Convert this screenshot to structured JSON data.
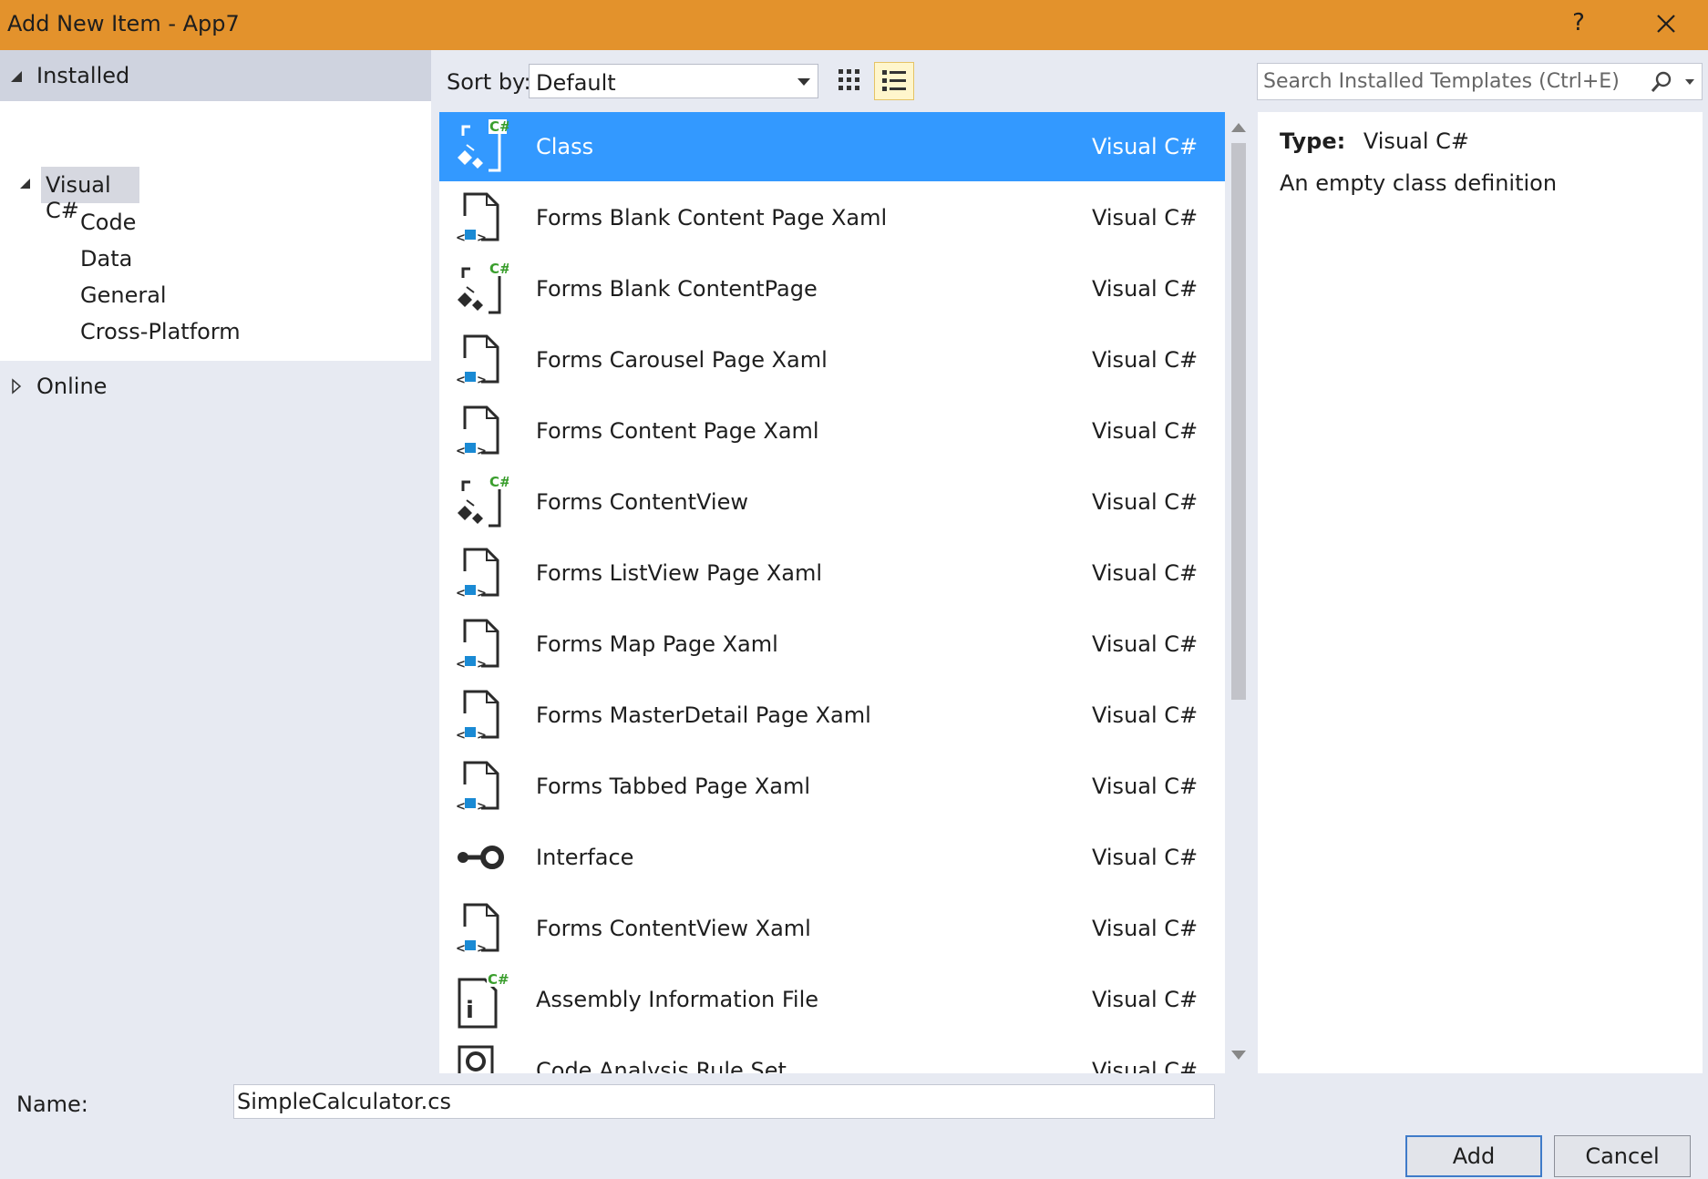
{
  "window": {
    "title": "Add New Item - App7",
    "help_label": "?"
  },
  "tree": {
    "installed_label": "Installed",
    "items": [
      {
        "label": "Visual C#"
      },
      {
        "label": "Code"
      },
      {
        "label": "Data"
      },
      {
        "label": "General"
      },
      {
        "label": "Cross-Platform"
      }
    ],
    "online_label": "Online"
  },
  "toolbar": {
    "sort_label": "Sort by:",
    "sort_value": "Default",
    "search_placeholder": "Search Installed Templates (Ctrl+E)"
  },
  "templates": [
    {
      "name": "Class",
      "lang": "Visual C#",
      "icon": "class-csharp-icon",
      "selected": true
    },
    {
      "name": "Forms Blank Content Page Xaml",
      "lang": "Visual C#",
      "icon": "xaml-page-icon"
    },
    {
      "name": "Forms Blank ContentPage",
      "lang": "Visual C#",
      "icon": "class-csharp-icon"
    },
    {
      "name": "Forms Carousel Page Xaml",
      "lang": "Visual C#",
      "icon": "xaml-page-icon"
    },
    {
      "name": "Forms Content Page Xaml",
      "lang": "Visual C#",
      "icon": "xaml-page-icon"
    },
    {
      "name": "Forms ContentView",
      "lang": "Visual C#",
      "icon": "class-csharp-icon"
    },
    {
      "name": "Forms ListView Page Xaml",
      "lang": "Visual C#",
      "icon": "xaml-page-icon"
    },
    {
      "name": "Forms Map Page Xaml",
      "lang": "Visual C#",
      "icon": "xaml-page-icon"
    },
    {
      "name": "Forms MasterDetail Page Xaml",
      "lang": "Visual C#",
      "icon": "xaml-page-icon"
    },
    {
      "name": "Forms Tabbed Page Xaml",
      "lang": "Visual C#",
      "icon": "xaml-page-icon"
    },
    {
      "name": "Interface",
      "lang": "Visual C#",
      "icon": "interface-icon"
    },
    {
      "name": "Forms ContentView Xaml",
      "lang": "Visual C#",
      "icon": "xaml-page-icon"
    },
    {
      "name": "Assembly Information File",
      "lang": "Visual C#",
      "icon": "assembly-info-icon"
    },
    {
      "name": "Code Analysis Rule Set",
      "lang": "Visual C#",
      "icon": "rule-set-icon"
    }
  ],
  "details": {
    "type_label": "Type:",
    "type_value": "Visual C#",
    "description": "An empty class definition"
  },
  "footer": {
    "name_label": "Name:",
    "name_value": "SimpleCalculator.cs",
    "add_label": "Add",
    "cancel_label": "Cancel"
  },
  "colors": {
    "titlebar": "#e3922c",
    "selection": "#3399ff",
    "csharp_badge": "#3a9e2d",
    "xaml_accent": "#1a8ad4"
  }
}
